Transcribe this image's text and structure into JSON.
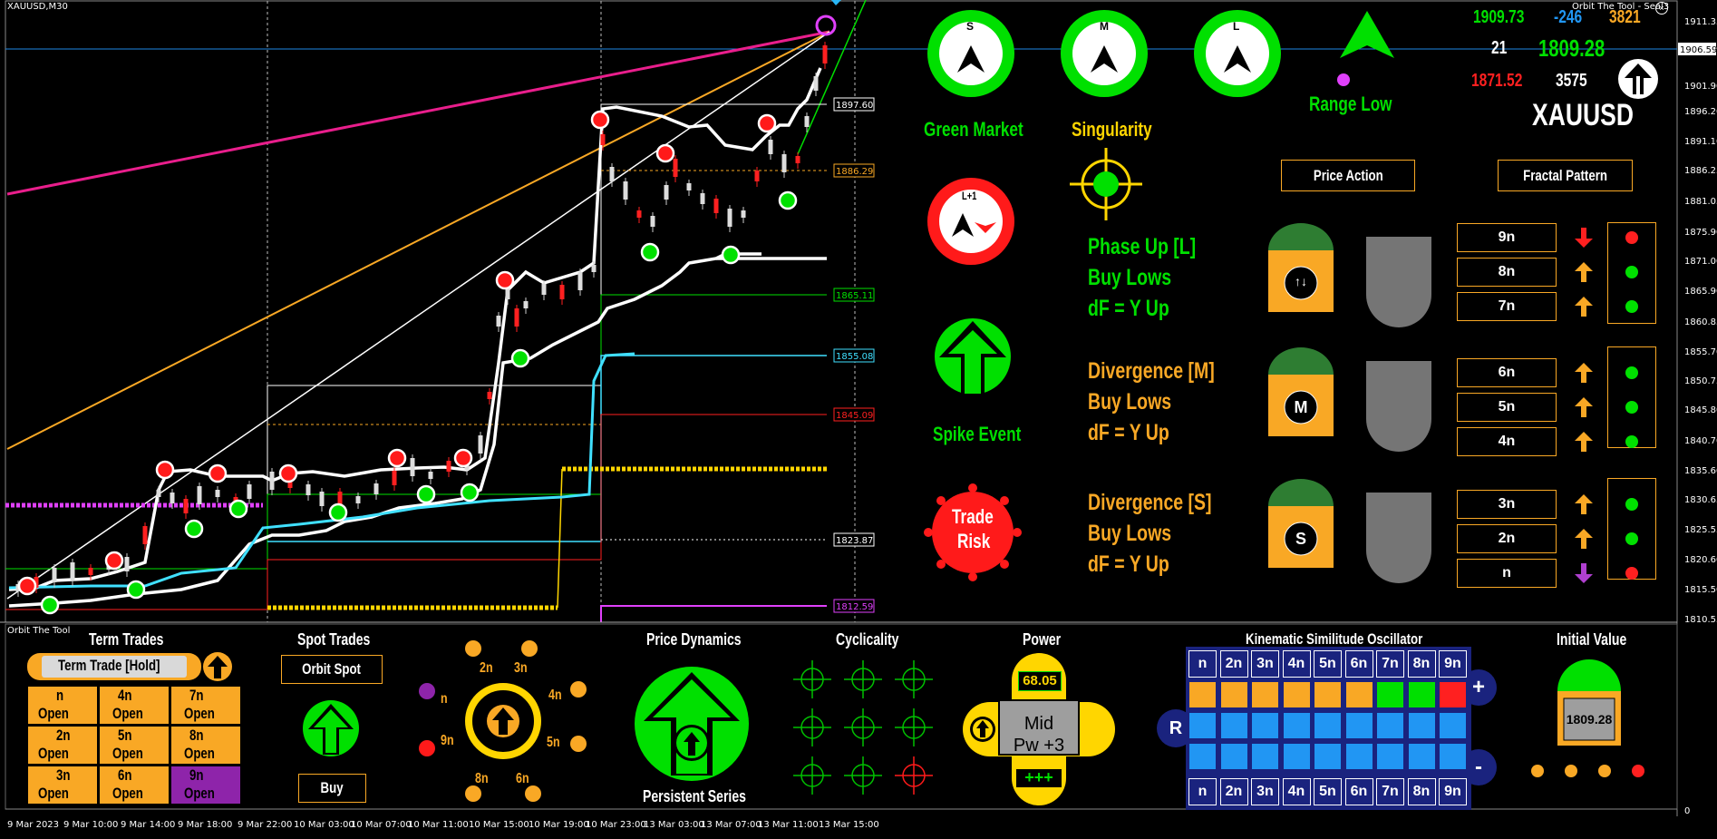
{
  "window": {
    "symbol_timeframe": "XAUUSD,M30",
    "indicator_title": "Orbit The Tool - Seal3",
    "panel_title": "Orbit The Tool"
  },
  "price_axis": [
    "1911.35",
    "1906.59",
    "1901.90",
    "1896.20",
    "1891.10",
    "1886.25",
    "1881.05",
    "1875.90",
    "1871.00",
    "1865.90",
    "1860.85",
    "1855.70",
    "1850.75",
    "1845.80",
    "1840.70",
    "1835.60",
    "1830.65",
    "1825.55",
    "1820.60",
    "1815.50",
    "1810.55",
    "0"
  ],
  "current_price_axis": "1906.59",
  "time_axis": [
    "9 Mar 2023",
    "9 Mar 10:00",
    "9 Mar 14:00",
    "9 Mar 18:00",
    "9 Mar 22:00",
    "10 Mar 03:00",
    "10 Mar 07:00",
    "10 Mar 11:00",
    "10 Mar 15:00",
    "10 Mar 19:00",
    "10 Mar 23:00",
    "13 Mar 03:00",
    "13 Mar 07:00",
    "13 Mar 11:00",
    "13 Mar 15:00"
  ],
  "level_tags": [
    {
      "value": "1897.60",
      "color": "#ffffff"
    },
    {
      "value": "1886.29",
      "color": "#f9a825"
    },
    {
      "value": "1865.11",
      "color": "#00e000"
    },
    {
      "value": "1855.08",
      "color": "#40e0ff"
    },
    {
      "value": "1845.09",
      "color": "#ff2020"
    },
    {
      "value": "1823.87",
      "color": "#ffffff"
    },
    {
      "value": "1812.59",
      "color": "#e040fb"
    }
  ],
  "stats": {
    "high": "1909.73",
    "delta": "-246",
    "count": "3821",
    "n21": "21",
    "price": "1809.28",
    "low": "1871.52",
    "pts": "3575",
    "symbol": "XAUUSD"
  },
  "gauges": [
    {
      "label": "S"
    },
    {
      "label": "M"
    },
    {
      "label": "L"
    }
  ],
  "gauge_texts": {
    "green_market": "Green Market",
    "singularity": "Singularity",
    "range_low": "Range Low",
    "spike_event": "Spike Event",
    "trade_risk_line1": "Trade",
    "trade_risk_line2": "Risk",
    "l1": "L+1"
  },
  "buttons": {
    "price_action": "Price Action",
    "fractal_pattern": "Fractal Pattern"
  },
  "signals": [
    {
      "title": "Phase Up [L]",
      "line2": "Buy Lows",
      "line3": "dF = Y Up",
      "color": "#00e000",
      "badge": "↑↓"
    },
    {
      "title": "Divergence [M]",
      "line2": "Buy Lows",
      "line3": "dF = Y Up",
      "color": "#f9a825",
      "badge": "M"
    },
    {
      "title": "Divergence [S]",
      "line2": "Buy Lows",
      "line3": "dF = Y Up",
      "color": "#f9a825",
      "badge": "S"
    }
  ],
  "fractals": [
    {
      "label": "9n",
      "arrow": "down",
      "arrow_color": "#ff2020",
      "dot": "#ff2020"
    },
    {
      "label": "8n",
      "arrow": "up",
      "arrow_color": "#f9a825",
      "dot": "#00e000"
    },
    {
      "label": "7n",
      "arrow": "up",
      "arrow_color": "#f9a825",
      "dot": "#00e000"
    },
    {
      "label": "6n",
      "arrow": "up",
      "arrow_color": "#f9a825",
      "dot": "#00e000"
    },
    {
      "label": "5n",
      "arrow": "up",
      "arrow_color": "#f9a825",
      "dot": "#00e000"
    },
    {
      "label": "4n",
      "arrow": "up",
      "arrow_color": "#f9a825",
      "dot": "#00e000"
    },
    {
      "label": "3n",
      "arrow": "up",
      "arrow_color": "#f9a825",
      "dot": "#00e000"
    },
    {
      "label": "2n",
      "arrow": "up",
      "arrow_color": "#f9a825",
      "dot": "#00e000"
    },
    {
      "label": "n",
      "arrow": "down",
      "arrow_color": "#b040d0",
      "dot": "#ff2020"
    }
  ],
  "term_trades": {
    "title": "Term Trades",
    "hold_label": "Term Trade [Hold]",
    "cells": [
      {
        "l1": "n",
        "l2": "Open",
        "color": "#f9a825"
      },
      {
        "l1": "4n",
        "l2": "Open",
        "color": "#f9a825"
      },
      {
        "l1": "7n",
        "l2": "Open",
        "color": "#f9a825"
      },
      {
        "l1": "2n",
        "l2": "Open",
        "color": "#f9a825"
      },
      {
        "l1": "5n",
        "l2": "Open",
        "color": "#f9a825"
      },
      {
        "l1": "8n",
        "l2": "Open",
        "color": "#f9a825"
      },
      {
        "l1": "3n",
        "l2": "Open",
        "color": "#f9a825"
      },
      {
        "l1": "6n",
        "l2": "Open",
        "color": "#f9a825"
      },
      {
        "l1": "9n",
        "l2": "Open",
        "color": "#8e24aa"
      }
    ]
  },
  "spot_trades": {
    "title": "Spot Trades",
    "orbit_spot": "Orbit Spot",
    "buy": "Buy"
  },
  "orbit_dial": [
    {
      "label": "2n"
    },
    {
      "label": "3n"
    },
    {
      "label": "4n"
    },
    {
      "label": "5n"
    },
    {
      "label": "6n"
    },
    {
      "label": "8n"
    },
    {
      "label": "9n"
    },
    {
      "label": "n"
    }
  ],
  "price_dynamics": {
    "title": "Price Dynamics",
    "subtitle": "Persistent Series"
  },
  "cyclicality": {
    "title": "Cyclicality"
  },
  "power": {
    "title": "Power",
    "value": "68.05",
    "state1": "Mid",
    "state2": "Pw +3",
    "bar": "+++"
  },
  "kso": {
    "title": "Kinematic Similitude Oscillator",
    "headers": [
      "n",
      "2n",
      "3n",
      "4n",
      "5n",
      "6n",
      "7n",
      "8n",
      "9n"
    ],
    "row1": [
      "#f9a825",
      "#f9a825",
      "#f9a825",
      "#f9a825",
      "#f9a825",
      "#f9a825",
      "#00e000",
      "#00e000",
      "#ff2020"
    ],
    "plus": "+",
    "minus": "-",
    "r": "R"
  },
  "initial_value": {
    "title": "Initial Value",
    "value": "1809.28",
    "dots": [
      "#f9a825",
      "#f9a825",
      "#f9a825",
      "#ff2020"
    ]
  }
}
